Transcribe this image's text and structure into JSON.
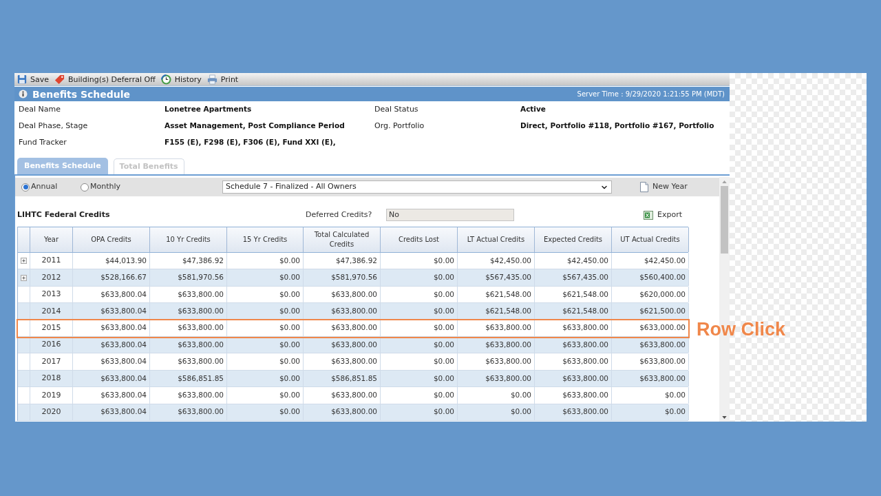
{
  "toolbar": [
    {
      "kind": "save",
      "label": "Save"
    },
    {
      "kind": "tag",
      "label": "Building(s) Deferral Off"
    },
    {
      "kind": "history",
      "label": "History"
    },
    {
      "kind": "print",
      "label": "Print"
    }
  ],
  "header": {
    "title": "Benefits Schedule",
    "server_time": "Server Time : 9/29/2020 1:21:55 PM (MDT)"
  },
  "deal_info": [
    {
      "label": "Deal Name",
      "value": "Lonetree Apartments"
    },
    {
      "label": "Deal Status",
      "value": "Active"
    },
    {
      "label": "Deal Phase, Stage",
      "value": "Asset Management, Post Compliance Period"
    },
    {
      "label": "Org. Portfolio",
      "value": "Direct, Portfolio #118, Portfolio #167, Portfolio"
    },
    {
      "label": "Fund Tracker",
      "value": "F155 (E), F298 (E), F306 (E), Fund XXI (E),"
    }
  ],
  "tabs": [
    {
      "label": "Benefits Schedule",
      "selected": true
    },
    {
      "label": "Total Benefits",
      "selected": false
    }
  ],
  "period_options": [
    {
      "label": "Annual",
      "selected": true
    },
    {
      "label": "Monthly",
      "selected": false
    }
  ],
  "schedule_select": {
    "value": "Schedule 7 - Finalized - All Owners"
  },
  "new_year_button": {
    "label": "New Year"
  },
  "section_title": "LIHTC Federal Credits",
  "deferred_credits": {
    "label": "Deferred Credits?",
    "value": "No",
    "disabled": true
  },
  "export_button": {
    "label": "Export"
  },
  "table": {
    "columns": [
      "Year",
      "OPA Credits",
      "10 Yr Credits",
      "15 Yr Credits",
      "Total Calculated Credits",
      "Credits Lost",
      "LT Actual Credits",
      "Expected Credits",
      "UT Actual Credits"
    ],
    "rows": [
      {
        "expandable": true,
        "selected": false,
        "cells": [
          "2011",
          "$44,013.90",
          "$47,386.92",
          "$0.00",
          "$47,386.92",
          "$0.00",
          "$42,450.00",
          "$42,450.00",
          "$42,450.00"
        ]
      },
      {
        "expandable": true,
        "selected": false,
        "cells": [
          "2012",
          "$528,166.67",
          "$581,970.56",
          "$0.00",
          "$581,970.56",
          "$0.00",
          "$567,435.00",
          "$567,435.00",
          "$560,400.00"
        ]
      },
      {
        "expandable": false,
        "selected": false,
        "cells": [
          "2013",
          "$633,800.04",
          "$633,800.00",
          "$0.00",
          "$633,800.00",
          "$0.00",
          "$621,548.00",
          "$621,548.00",
          "$620,000.00"
        ]
      },
      {
        "expandable": false,
        "selected": false,
        "cells": [
          "2014",
          "$633,800.04",
          "$633,800.00",
          "$0.00",
          "$633,800.00",
          "$0.00",
          "$621,548.00",
          "$621,548.00",
          "$621,500.00"
        ]
      },
      {
        "expandable": false,
        "selected": true,
        "cells": [
          "2015",
          "$633,800.04",
          "$633,800.00",
          "$0.00",
          "$633,800.00",
          "$0.00",
          "$633,800.00",
          "$633,800.00",
          "$633,000.00"
        ]
      },
      {
        "expandable": false,
        "selected": false,
        "cells": [
          "2016",
          "$633,800.04",
          "$633,800.00",
          "$0.00",
          "$633,800.00",
          "$0.00",
          "$633,800.00",
          "$633,800.00",
          "$633,800.00"
        ]
      },
      {
        "expandable": false,
        "selected": false,
        "cells": [
          "2017",
          "$633,800.04",
          "$633,800.00",
          "$0.00",
          "$633,800.00",
          "$0.00",
          "$633,800.00",
          "$633,800.00",
          "$633,800.00"
        ]
      },
      {
        "expandable": false,
        "selected": false,
        "cells": [
          "2018",
          "$633,800.04",
          "$586,851.85",
          "$0.00",
          "$586,851.85",
          "$0.00",
          "$633,800.00",
          "$633,800.00",
          "$633,800.00"
        ]
      },
      {
        "expandable": false,
        "selected": false,
        "cells": [
          "2019",
          "$633,800.04",
          "$633,800.00",
          "$0.00",
          "$633,800.00",
          "$0.00",
          "$0.00",
          "$633,800.00",
          "$0.00"
        ]
      },
      {
        "expandable": false,
        "selected": false,
        "cells": [
          "2020",
          "$633,800.04",
          "$633,800.00",
          "$0.00",
          "$633,800.00",
          "$0.00",
          "$0.00",
          "$633,800.00",
          "$0.00"
        ]
      }
    ]
  },
  "callout": {
    "text": "Row Click"
  }
}
